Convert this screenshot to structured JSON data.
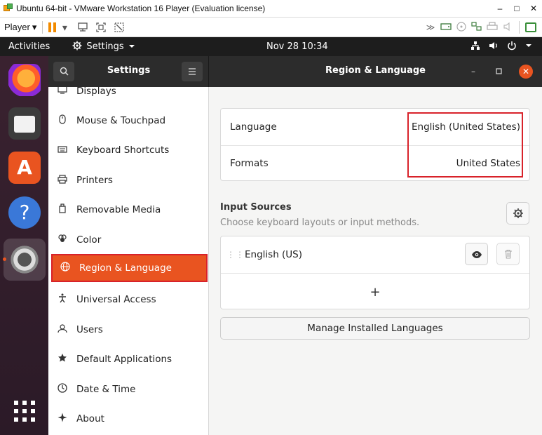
{
  "vm": {
    "window_title": "Ubuntu 64-bit - VMware Workstation 16 Player (Evaluation license)",
    "player_label": "Player",
    "dropdown_glyph": "▾",
    "minimize": "–",
    "maximize": "□",
    "close": "✕"
  },
  "topbar": {
    "activities": "Activities",
    "app_menu": "Settings",
    "clock": "Nov 28  10:34"
  },
  "settings": {
    "sidebar_title": "Settings",
    "panel_title": "Region & Language",
    "sidebar_items": [
      {
        "label": "Displays",
        "icon": "display-icon"
      },
      {
        "label": "Mouse & Touchpad",
        "icon": "mouse-icon"
      },
      {
        "label": "Keyboard Shortcuts",
        "icon": "keyboard-icon"
      },
      {
        "label": "Printers",
        "icon": "printer-icon"
      },
      {
        "label": "Removable Media",
        "icon": "removable-media-icon"
      },
      {
        "label": "Color",
        "icon": "color-icon"
      },
      {
        "label": "Region & Language",
        "icon": "globe-icon",
        "active": true
      },
      {
        "label": "Universal Access",
        "icon": "accessibility-icon"
      },
      {
        "label": "Users",
        "icon": "users-icon"
      },
      {
        "label": "Default Applications",
        "icon": "star-icon"
      },
      {
        "label": "Date & Time",
        "icon": "clock-icon"
      },
      {
        "label": "About",
        "icon": "about-icon"
      }
    ],
    "language": {
      "label": "Language",
      "value": "English (United States)"
    },
    "formats": {
      "label": "Formats",
      "value": "United States"
    },
    "input_sources": {
      "title": "Input Sources",
      "subtitle": "Choose keyboard layouts or input methods.",
      "items": [
        "English (US)"
      ],
      "add_glyph": "+"
    },
    "manage_button": "Manage Installed Languages"
  },
  "colors": {
    "accent": "#e95420",
    "highlight": "#d8222a",
    "header": "#2c2c2c"
  }
}
